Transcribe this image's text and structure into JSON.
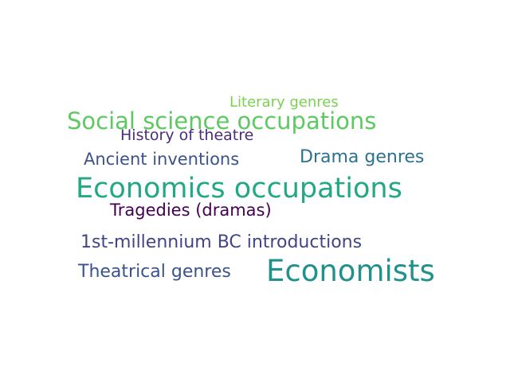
{
  "wordcloud": {
    "words": [
      {
        "key": "literary_genres",
        "text": "Literary genres",
        "color": "#7ad151"
      },
      {
        "key": "social_science_occupations",
        "text": "Social science occupations",
        "color": "#5ec962"
      },
      {
        "key": "history_of_theatre",
        "text": "History of theatre",
        "color": "#472d7b"
      },
      {
        "key": "ancient_inventions",
        "text": "Ancient inventions",
        "color": "#3b528b"
      },
      {
        "key": "drama_genres",
        "text": "Drama genres",
        "color": "#2c728e"
      },
      {
        "key": "economics_occupations",
        "text": "Economics occupations",
        "color": "#22a884"
      },
      {
        "key": "tragedies_dramas",
        "text": "Tragedies (dramas)",
        "color": "#440154"
      },
      {
        "key": "first_millennium_bc_introductions",
        "text": "1st-millennium BC introductions",
        "color": "#414487"
      },
      {
        "key": "theatrical_genres",
        "text": "Theatrical genres",
        "color": "#3b528b"
      },
      {
        "key": "economists",
        "text": "Economists",
        "color": "#21918c"
      }
    ]
  }
}
